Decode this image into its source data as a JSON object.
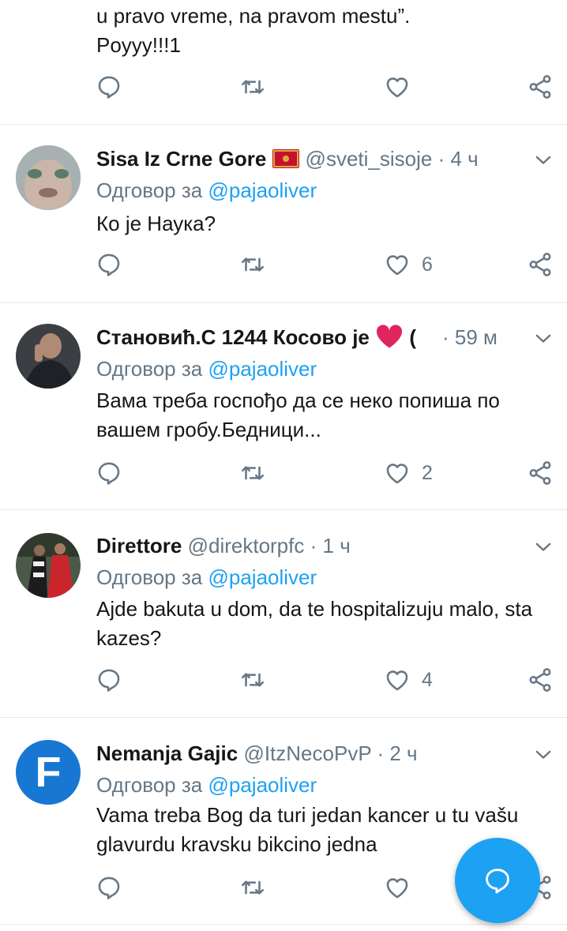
{
  "colors": {
    "accent": "#1da1f2",
    "muted": "#657786",
    "text": "#14171a",
    "divider": "#e1e8ed"
  },
  "top_tweet": {
    "text_lines": [
      "u pravo vreme, na pravom mestu”.",
      "Poyyy!!!1"
    ]
  },
  "tweets": [
    {
      "name": "Sisa Iz Crne Gore",
      "name_emoji": "montenegro-flag",
      "handle": "@sveti_sisoje",
      "dot": "·",
      "time": "4 ч",
      "reply_prefix": "Одговор за",
      "reply_to": "@pajaoliver",
      "text": "Ко је Наука?",
      "like_count": "6"
    },
    {
      "name": "Становић.С 1244 Косово је",
      "name_emoji": "red-heart",
      "name_trailing": "(",
      "handle": "",
      "dot": "·",
      "time": "59 м",
      "reply_prefix": "Одговор за",
      "reply_to": "@pajaoliver",
      "text": "Вама треба госпођо да се неко попиша по вашем гробу.Бедници...",
      "like_count": "2"
    },
    {
      "name": "Direttore",
      "handle": "@direktorpfc",
      "dot": "·",
      "time": "1 ч",
      "reply_prefix": "Одговор за",
      "reply_to": "@pajaoliver",
      "text": "Ajde bakuta u dom, da te hospitalizuju malo, sta kazes?",
      "like_count": "4"
    },
    {
      "name": "Nemanja Gajic",
      "handle": "@ItzNecoPvP",
      "dot": "·",
      "time": "2 ч",
      "reply_prefix": "Одговор за",
      "reply_to": "@pajaoliver",
      "text": "Vama treba Bog da turi jedan kancer u tu vašu glavurdu kravsku bikcino jedna",
      "like_count": "",
      "avatar_letter": "F"
    }
  ],
  "icons": {
    "reply": "reply-icon",
    "retweet": "retweet-icon",
    "like": "like-icon",
    "share": "share-icon",
    "more": "chevron-down-icon",
    "compose": "compose-reply-icon"
  }
}
